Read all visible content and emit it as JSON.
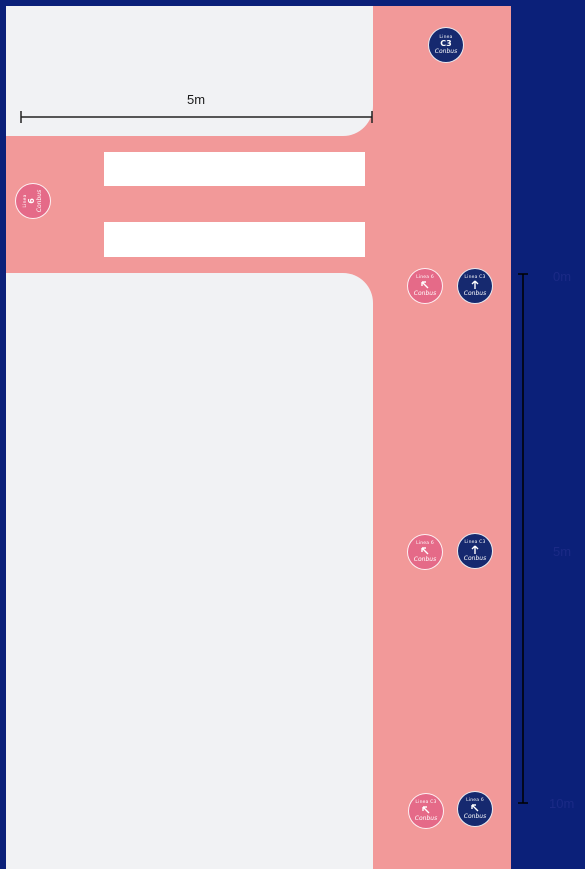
{
  "dimension": {
    "label": "5m"
  },
  "scale": {
    "ticks": [
      "0m",
      "5m",
      "10m"
    ]
  },
  "badges": {
    "top_right": {
      "line": "Linea",
      "code": "C3",
      "brand": "Conbus"
    },
    "left": {
      "line": "Linea",
      "code": "6",
      "brand": "Conbus"
    },
    "row1_left": {
      "line": "Linea 6",
      "brand": "Conbus"
    },
    "row1_right": {
      "line": "Linea C3",
      "brand": "Conbus"
    },
    "row2_left": {
      "line": "Linea 6",
      "brand": "Conbus"
    },
    "row2_right": {
      "line": "Linea C3",
      "brand": "Conbus"
    },
    "row3_left": {
      "line": "Linea C3",
      "brand": "Conbus"
    },
    "row3_right": {
      "line": "Linea 6",
      "brand": "Conbus"
    }
  },
  "colors": {
    "background": "#0b2079",
    "sidewalk": "#f1f2f4",
    "street": "#f29999",
    "crosswalk": "#ffffff",
    "badge_navy": "#16296f",
    "badge_rose": "#e56a88"
  }
}
